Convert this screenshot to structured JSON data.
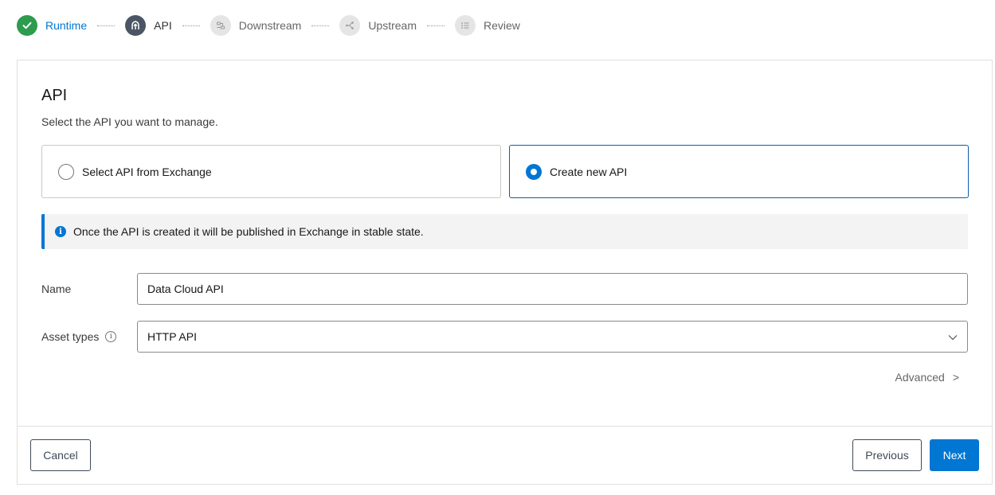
{
  "stepper": {
    "steps": [
      {
        "label": "Runtime",
        "state": "done",
        "icon": "check-icon"
      },
      {
        "label": "API",
        "state": "active",
        "icon": "api-icon"
      },
      {
        "label": "Downstream",
        "state": "pending",
        "icon": "downstream-icon"
      },
      {
        "label": "Upstream",
        "state": "pending",
        "icon": "upstream-icon"
      },
      {
        "label": "Review",
        "state": "pending",
        "icon": "list-icon"
      }
    ]
  },
  "card": {
    "title": "API",
    "subtitle": "Select the API you want to manage.",
    "choices": [
      {
        "label": "Select API from Exchange",
        "selected": false
      },
      {
        "label": "Create new API",
        "selected": true
      }
    ],
    "notice": "Once the API is created it will be published in Exchange in stable state.",
    "fields": {
      "name_label": "Name",
      "name_value": "Data Cloud API",
      "asset_types_label": "Asset types",
      "asset_types_value": "HTTP API"
    },
    "advanced_label": "Advanced",
    "advanced_chevron": ">"
  },
  "footer": {
    "cancel_label": "Cancel",
    "previous_label": "Previous",
    "next_label": "Next"
  },
  "colors": {
    "accent": "#0176d3",
    "success": "#2e9b4f",
    "active_step": "#4b5563"
  }
}
